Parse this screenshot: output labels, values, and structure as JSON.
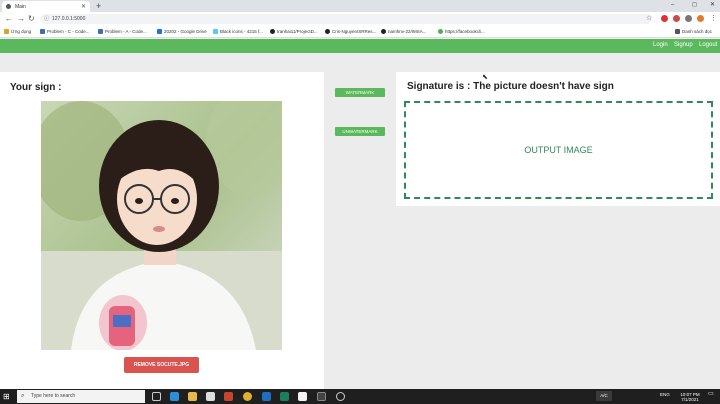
{
  "browser": {
    "tab_title": "Main",
    "url": "127.0.0.1:5000",
    "new_tab": "+",
    "window_controls": [
      "–",
      "◻",
      "✕"
    ]
  },
  "bookmarks": [
    {
      "label": "Ứng dụng",
      "color": "#e0a020"
    },
    {
      "label": "Problem - C - Code...",
      "color": "#3b6fb6"
    },
    {
      "label": "Problem - A - Code...",
      "color": "#3b6fb6"
    },
    {
      "label": "20202 - Google Drive",
      "color": "#1a73e8"
    },
    {
      "label": "Black icons - 4215 f...",
      "color": "#5ac8fa"
    },
    {
      "label": "tranhai11/ProjectD...",
      "color": "#222222"
    },
    {
      "label": "Cris-Nguyen/SRRes...",
      "color": "#222222"
    },
    {
      "label": "namhnv-22/IMSA...",
      "color": "#222222"
    },
    {
      "label": "https://facebookcli...",
      "color": "#4caf50"
    },
    {
      "label": "Danh sách đọc",
      "color": "#555555"
    }
  ],
  "appnav": {
    "login": "Login",
    "signup": "Signup",
    "logout": "Logout"
  },
  "left": {
    "title": "Your sign :",
    "remove_button": "REMOVE SOCUTE.JPG"
  },
  "middle": {
    "watermark_button": "WATERMARK",
    "unwatermark_button": "UNWATERMARK"
  },
  "right": {
    "result": "Signature is : The picture doesn't have sign",
    "output_placeholder": "OUTPUT IMAGE"
  },
  "taskbar": {
    "search_placeholder": "Type here to search",
    "lang": "A/C",
    "input": "ENG",
    "time": "10:07 PM",
    "date": "7/1/2021"
  },
  "colors": {
    "accent_green": "#5cb85c",
    "danger_red": "#d9534f",
    "output_border": "#2e8b57"
  }
}
